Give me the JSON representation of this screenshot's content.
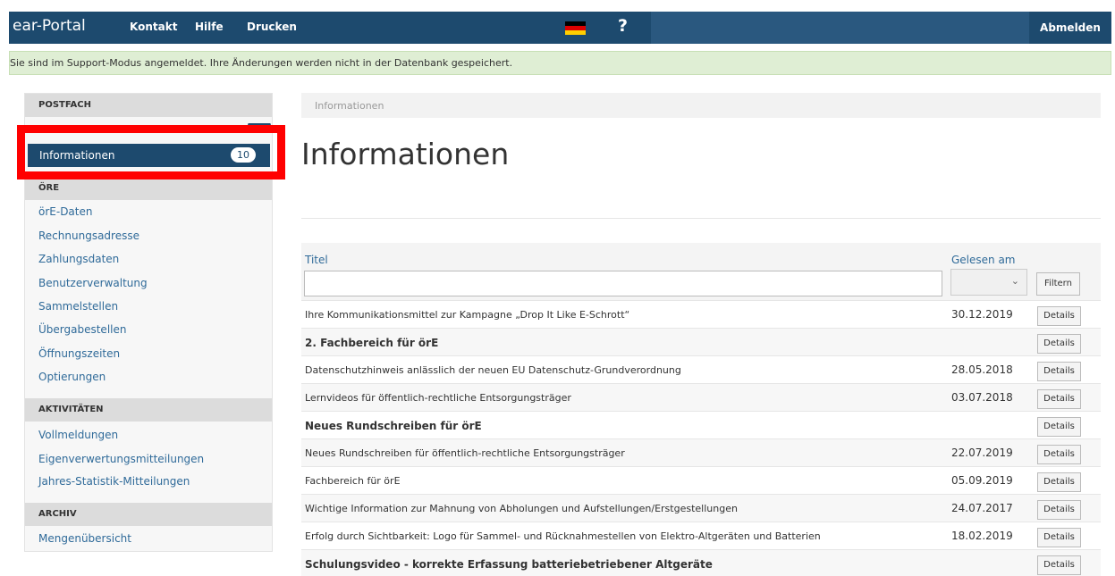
{
  "topbar": {
    "brand": "ear-Portal",
    "nav": [
      "Kontakt",
      "Hilfe",
      "Drucken"
    ],
    "help": "?",
    "logout": "Abmelden"
  },
  "banner": "Sie sind im Support-Modus angemeldet. Ihre Änderungen werden nicht in der Datenbank gespeichert.",
  "sidebar": {
    "postfach_head": "POSTFACH",
    "active_label": "Informationen",
    "active_count": "10",
    "oere_head": "ÖRE",
    "oere_items": [
      "örE-Daten",
      "Rechnungsadresse",
      "Zahlungsdaten",
      "Benutzerverwaltung",
      "Sammelstellen",
      "Übergabestellen",
      "Öffnungszeiten",
      "Optierungen"
    ],
    "aktiv_head": "AKTIVITÄTEN",
    "aktiv_items": [
      "Vollmeldungen",
      "Eigenverwertungsmitteilungen",
      "Jahres-Statistik-Mitteilungen"
    ],
    "archiv_head": "ARCHIV",
    "archiv_items": [
      "Mengenübersicht"
    ]
  },
  "breadcrumb": "Informationen",
  "page_title": "Informationen",
  "table": {
    "col_title": "Titel",
    "col_read": "Gelesen am",
    "filter_label": "Filtern",
    "details_label": "Details",
    "rows": [
      {
        "title": "Ihre Kommunikationsmittel zur Kampagne „Drop It Like E-Schrott“",
        "date": "30.12.2019",
        "bold": false
      },
      {
        "title": "2. Fachbereich für örE",
        "date": "",
        "bold": true
      },
      {
        "title": "Datenschutzhinweis anlässlich der neuen EU Datenschutz-Grundverordnung",
        "date": "28.05.2018",
        "bold": false
      },
      {
        "title": "Lernvideos für öffentlich-rechtliche Entsorgungsträger",
        "date": "03.07.2018",
        "bold": false
      },
      {
        "title": "Neues Rundschreiben für örE",
        "date": "",
        "bold": true
      },
      {
        "title": "Neues Rundschreiben für öffentlich-rechtliche Entsorgungsträger",
        "date": "22.07.2019",
        "bold": false
      },
      {
        "title": "Fachbereich für örE",
        "date": "05.09.2019",
        "bold": false
      },
      {
        "title": "Wichtige Information zur Mahnung von Abholungen und Aufstellungen/Erstgestellungen",
        "date": "24.07.2017",
        "bold": false
      },
      {
        "title": "Erfolg durch Sichtbarkeit: Logo für Sammel- und Rücknahmestellen von Elektro-Altgeräten und Batterien",
        "date": "18.02.2019",
        "bold": false
      },
      {
        "title": "Schulungsvideo - korrekte Erfassung batteriebetriebener Altgeräte",
        "date": "",
        "bold": true
      }
    ]
  },
  "colors": {
    "brand": "#1d4a6e",
    "link": "#2f6a99",
    "banner": "#dfeed4",
    "highlight": "#ff0000"
  }
}
